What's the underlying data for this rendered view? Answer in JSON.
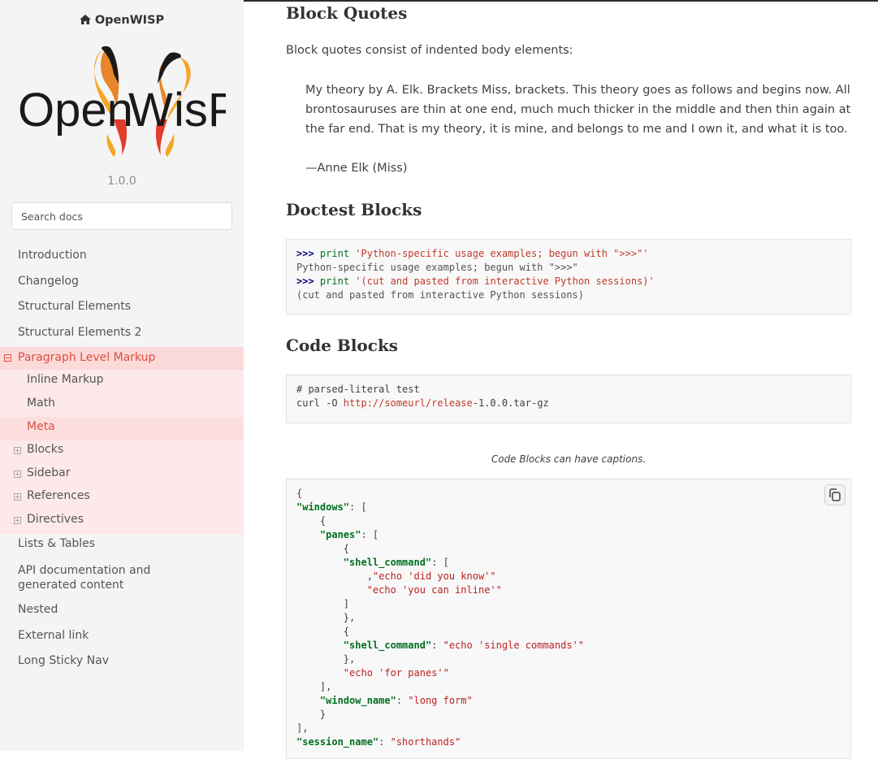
{
  "sidebar": {
    "brand": "OpenWISP",
    "logo_text": "OpenWISP",
    "version": "1.0.0",
    "search_placeholder": "Search docs",
    "nav": [
      {
        "label": "Introduction"
      },
      {
        "label": "Changelog"
      },
      {
        "label": "Structural Elements"
      },
      {
        "label": "Structural Elements 2"
      },
      {
        "label": "Paragraph Level Markup"
      },
      {
        "label": "Inline Markup"
      },
      {
        "label": "Math"
      },
      {
        "label": "Meta"
      },
      {
        "label": "Blocks"
      },
      {
        "label": "Sidebar"
      },
      {
        "label": "References"
      },
      {
        "label": "Directives"
      },
      {
        "label": "Lists & Tables"
      },
      {
        "label": "API documentation and generated content"
      },
      {
        "label": "Nested"
      },
      {
        "label": "External link"
      },
      {
        "label": "Long Sticky Nav"
      }
    ]
  },
  "main": {
    "block_quotes": {
      "heading": "Block Quotes",
      "intro": "Block quotes consist of indented body elements:",
      "quote": "My theory by A. Elk. Brackets Miss, brackets. This theory goes as follows and begins now. All brontosauruses are thin at one end, much much thicker in the middle and then thin again at the far end. That is my theory, it is mine, and belongs to me and I own it, and what it is too.",
      "attribution": "—Anne Elk (Miss)"
    },
    "doctest": {
      "heading": "Doctest Blocks",
      "prompt": ">>>",
      "keyword": "print",
      "line1_str": "'Python-specific usage examples; begun with \">>>\"'",
      "line2": "Python-specific usage examples; begun with \">>>\"",
      "line3_str": "'(cut and pasted from interactive Python sessions)'",
      "line4": "(cut and pasted from interactive Python sessions)"
    },
    "code_blocks": {
      "heading": "Code Blocks",
      "comment": "# parsed-literal test",
      "cmd": "curl -O ",
      "url": "http://someurl/release",
      "suffix": "-1.0.0.tar-gz",
      "caption": "Code Blocks can have captions.",
      "json_lines": [
        {
          "pre": "{"
        },
        {
          "pre": "",
          "key": "\"windows\"",
          "post": ": ["
        },
        {
          "pre": "    {"
        },
        {
          "pre": "    ",
          "key": "\"panes\"",
          "post": ": ["
        },
        {
          "pre": "        {"
        },
        {
          "pre": "        ",
          "key": "\"shell_command\"",
          "post": ": ["
        },
        {
          "pre": "            ",
          "str": "\"echo 'did you know'\"",
          "post": ","
        },
        {
          "pre": "            ",
          "str": "\"echo 'you can inline'\""
        },
        {
          "pre": "        ]"
        },
        {
          "pre": "        },"
        },
        {
          "pre": "        {"
        },
        {
          "pre": "        ",
          "key": "\"shell_command\"",
          "post": ": ",
          "str": "\"echo 'single commands'\""
        },
        {
          "pre": "        },"
        },
        {
          "pre": "        ",
          "str": "\"echo 'for panes'\""
        },
        {
          "pre": "    ],"
        },
        {
          "pre": "    ",
          "key": "\"window_name\"",
          "post": ": ",
          "str": "\"long form\""
        },
        {
          "pre": "    }"
        },
        {
          "pre": "],"
        },
        {
          "pre": "",
          "key": "\"session_name\"",
          "post": ": ",
          "str": "\"shorthands\""
        }
      ]
    }
  },
  "colors": {
    "accent_red": "#dd4e3f",
    "active_bg": "#fcdede",
    "sidebar_bg": "#f4f4f4"
  }
}
